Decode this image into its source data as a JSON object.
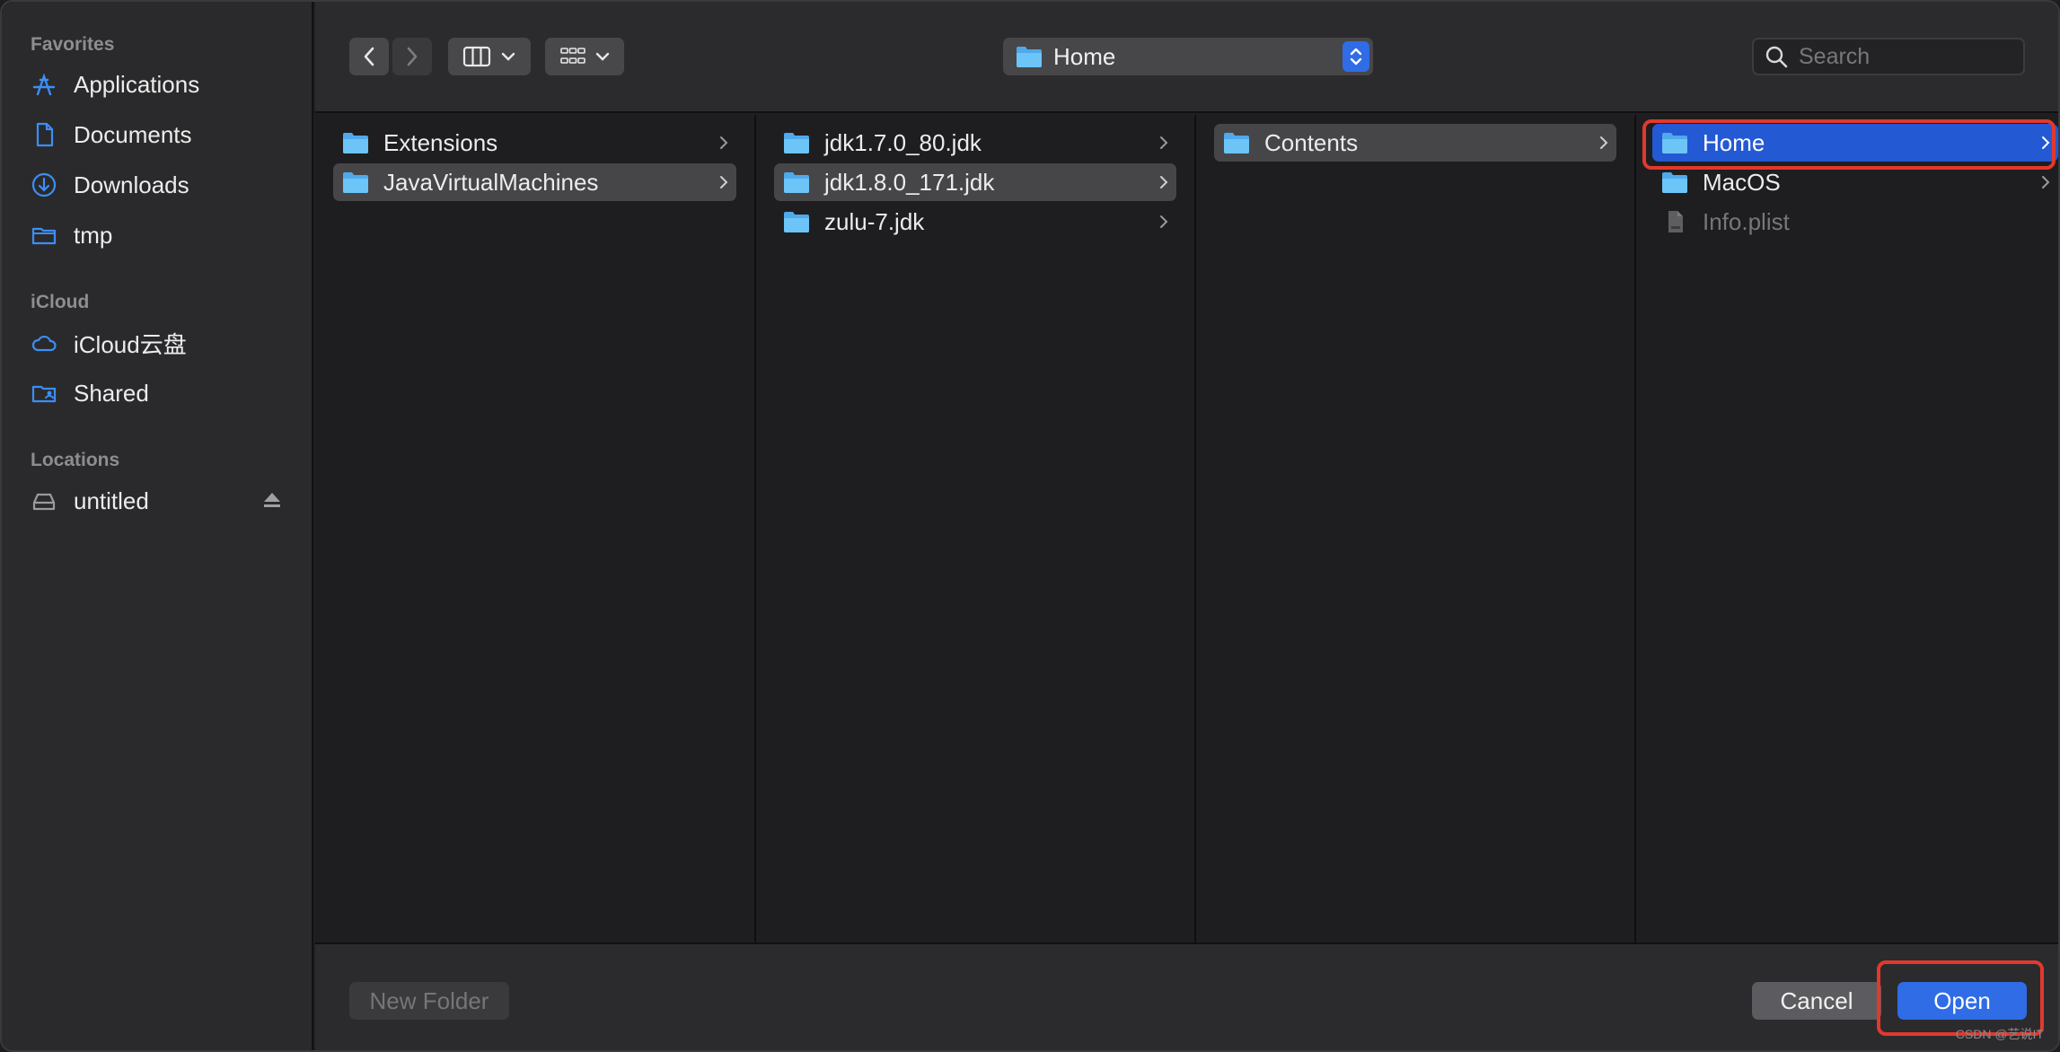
{
  "sidebar": {
    "sections": [
      {
        "label": "Favorites",
        "items": [
          {
            "label": "Applications",
            "icon": "applications-icon"
          },
          {
            "label": "Documents",
            "icon": "document-icon"
          },
          {
            "label": "Downloads",
            "icon": "downloads-icon"
          },
          {
            "label": "tmp",
            "icon": "folder-icon"
          }
        ]
      },
      {
        "label": "iCloud",
        "items": [
          {
            "label": "iCloud云盘",
            "icon": "icloud-icon"
          },
          {
            "label": "Shared",
            "icon": "shared-folder-icon"
          }
        ]
      },
      {
        "label": "Locations",
        "items": [
          {
            "label": "untitled",
            "icon": "disk-icon"
          }
        ]
      }
    ]
  },
  "toolbar": {
    "path_label": "Home",
    "search_placeholder": "Search"
  },
  "columns": [
    {
      "items": [
        {
          "label": "Extensions",
          "type": "folder",
          "state": "normal"
        },
        {
          "label": "JavaVirtualMachines",
          "type": "folder",
          "state": "selected-inactive"
        }
      ]
    },
    {
      "items": [
        {
          "label": "jdk1.7.0_80.jdk",
          "type": "folder",
          "state": "normal"
        },
        {
          "label": "jdk1.8.0_171.jdk",
          "type": "folder",
          "state": "selected-inactive"
        },
        {
          "label": "zulu-7.jdk",
          "type": "folder",
          "state": "normal"
        }
      ]
    },
    {
      "items": [
        {
          "label": "Contents",
          "type": "folder",
          "state": "selected-inactive"
        }
      ]
    },
    {
      "items": [
        {
          "label": "Home",
          "type": "folder",
          "state": "selected-active"
        },
        {
          "label": "MacOS",
          "type": "folder",
          "state": "normal"
        },
        {
          "label": "Info.plist",
          "type": "file",
          "state": "disabled"
        }
      ]
    }
  ],
  "bottom": {
    "new_folder": "New Folder",
    "cancel": "Cancel",
    "open": "Open"
  },
  "watermark": "CSDN @艺说IT",
  "colors": {
    "accent": "#2f6ce6",
    "selection_active": "#2459d4",
    "selection_inactive": "#464649",
    "annotation": "#e2392c",
    "folder": "#5cb8f2"
  }
}
